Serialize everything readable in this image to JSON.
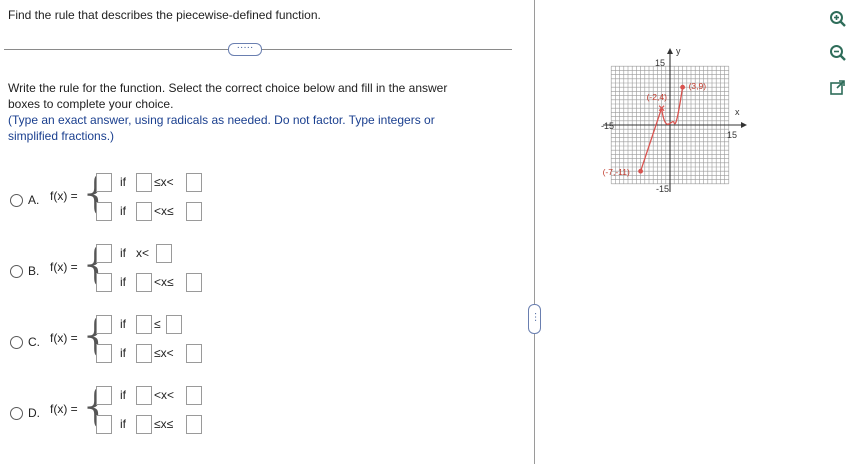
{
  "question": {
    "title": "Find the rule that describes the piecewise-defined function.",
    "more_button": "·····",
    "instruction_line1": "Write the rule for the function. Select the correct choice below and fill in the answer",
    "instruction_line2": "boxes to complete your choice.",
    "hint_line1": "(Type an exact answer, using radicals as needed. Do not factor. Type integers or",
    "hint_line2": "simplified fractions.)"
  },
  "choices": [
    {
      "letter": "A.",
      "fx": "f(x) =",
      "row1": {
        "if": "if",
        "op": "≤x<"
      },
      "row2": {
        "if": "if",
        "op": "<x≤"
      }
    },
    {
      "letter": "B.",
      "fx": "f(x) =",
      "row1": {
        "if": "if",
        "op": "x<"
      },
      "row2": {
        "if": "if",
        "op": "<x≤"
      }
    },
    {
      "letter": "C.",
      "fx": "f(x) =",
      "row1": {
        "if": "if",
        "op": "≤"
      },
      "row2": {
        "if": "if",
        "op": "≤x<"
      }
    },
    {
      "letter": "D.",
      "fx": "f(x) =",
      "row1": {
        "if": "if",
        "op": "<x<"
      },
      "row2": {
        "if": "if",
        "op": "≤x≤"
      }
    }
  ],
  "graph": {
    "x_label": "x",
    "y_label": "y",
    "x_min_label": "-15",
    "x_max_label": "15",
    "y_max_label": "15",
    "y_min_label": "-15",
    "points": [
      {
        "label": "(-7,-11)",
        "x": -7,
        "y": -11,
        "filled": true
      },
      {
        "label": "(-2,4)",
        "x": -2,
        "y": 4,
        "filled": false
      },
      {
        "label": "(3,9)",
        "x": 3,
        "y": 9,
        "filled": true
      }
    ],
    "line_color": "#d9534f",
    "x_range": [
      -15,
      15
    ],
    "y_range": [
      -15,
      15
    ]
  },
  "separator_dots": "···",
  "tools": [
    "zoom-in-icon",
    "zoom-out-icon",
    "popout-icon"
  ]
}
